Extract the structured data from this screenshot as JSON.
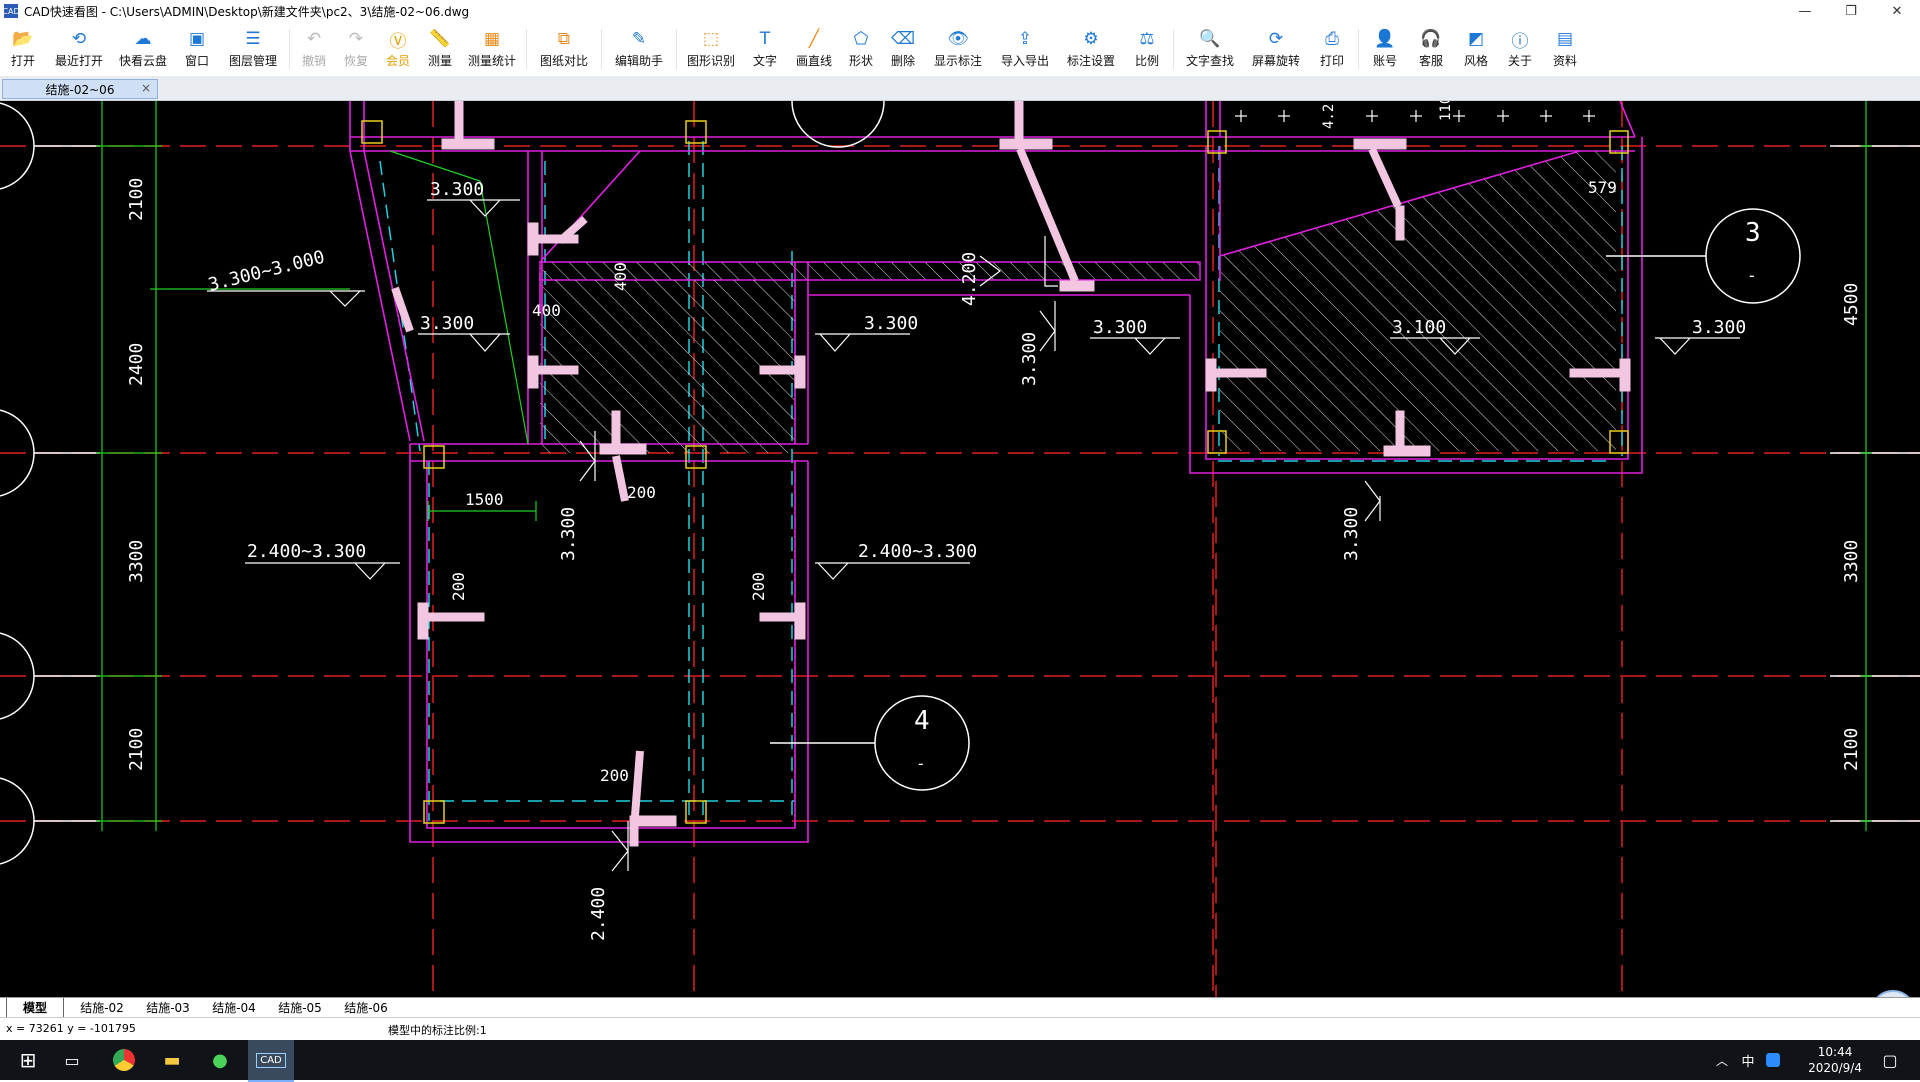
{
  "window": {
    "title": "CAD快速看图 - C:\\Users\\ADMIN\\Desktop\\新建文件夹\\pc2、3\\结施-02~06.dwg",
    "minimize_glyph": "—",
    "restore_glyph": "❐",
    "close_glyph": "✕"
  },
  "toolbar": {
    "open": "打开",
    "recent": "最近打开",
    "cloud": "快看云盘",
    "window": "窗口",
    "layers": "图层管理",
    "undo": "撤销",
    "redo": "恢复",
    "vip": "会员",
    "measure": "测量",
    "measure_stats": "测量统计",
    "compare": "图纸对比",
    "edit_helper": "编辑助手",
    "shape_recog": "图形识别",
    "text": "文字",
    "line": "画直线",
    "shape": "形状",
    "delete": "删除",
    "show_marks": "显示标注",
    "import_export": "导入导出",
    "mark_settings": "标注设置",
    "scale": "比例",
    "text_search": "文字查找",
    "screen_rotate": "屏幕旋转",
    "print": "打印",
    "account": "账号",
    "service": "客服",
    "style": "风格",
    "about": "关于",
    "resources": "资料"
  },
  "doc_tab": {
    "label": "结施-02~06",
    "close": "×"
  },
  "drawing": {
    "dims_left": [
      "2100",
      "2400",
      "3300",
      "2100"
    ],
    "dims_right": [
      "4500",
      "3300",
      "2100"
    ],
    "levels": [
      "3.300",
      "3.300~3.000",
      "3.300",
      "3.300",
      "3.300",
      "3.300",
      "3.100",
      "3.300",
      "2.400~3.300",
      "2.400~3.300",
      "3.300",
      "3.300",
      "2.400",
      "4.200"
    ],
    "dims_small": [
      "400",
      "400",
      "200",
      "1500",
      "200",
      "200",
      "200",
      "579",
      "4.2",
      "110"
    ],
    "section_marks": [
      "3",
      "4"
    ],
    "section_sub": [
      "-",
      "-"
    ]
  },
  "layout_tabs": [
    "模型",
    "结施-02",
    "结施-03",
    "结施-04",
    "结施-05",
    "结施-06"
  ],
  "status": {
    "coord": "x = 73261  y = -101795",
    "scale_note": "模型中的标注比例:1"
  },
  "taskbar": {
    "time": "10:44",
    "date": "2020/9/4",
    "ime": "中",
    "up_arrow": "︿"
  }
}
